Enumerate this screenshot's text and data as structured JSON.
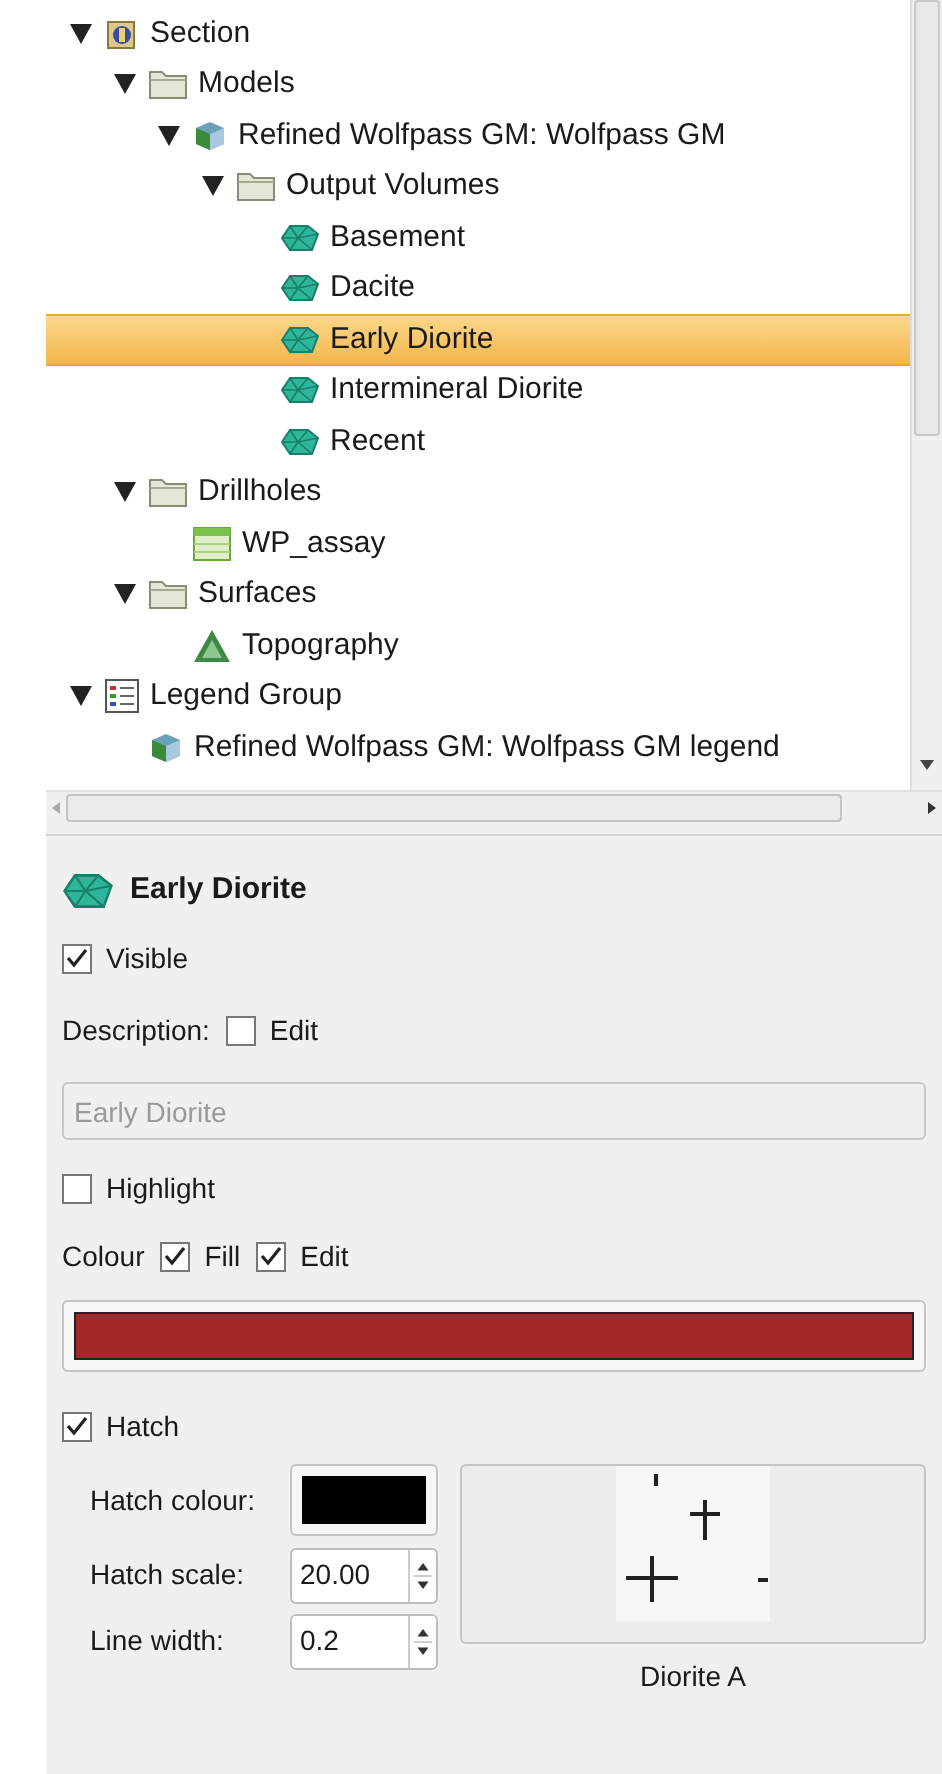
{
  "tree": {
    "nodes": [
      {
        "label": "Section",
        "kind": "section",
        "expanded": true,
        "selected": false,
        "children": [
          {
            "label": "Models",
            "kind": "folder",
            "expanded": true,
            "selected": false,
            "children": [
              {
                "label": "Refined Wolfpass GM: Wolfpass GM",
                "kind": "model",
                "expanded": true,
                "selected": false,
                "children": [
                  {
                    "label": "Output Volumes",
                    "kind": "folder",
                    "expanded": true,
                    "selected": false,
                    "children": [
                      {
                        "label": "Basement",
                        "kind": "volume",
                        "selected": false
                      },
                      {
                        "label": "Dacite",
                        "kind": "volume",
                        "selected": false
                      },
                      {
                        "label": "Early Diorite",
                        "kind": "volume",
                        "selected": true
                      },
                      {
                        "label": "Intermineral Diorite",
                        "kind": "volume",
                        "selected": false
                      },
                      {
                        "label": "Recent",
                        "kind": "volume",
                        "selected": false
                      }
                    ]
                  }
                ]
              }
            ]
          },
          {
            "label": "Drillholes",
            "kind": "folder",
            "expanded": true,
            "selected": false,
            "children": [
              {
                "label": "WP_assay",
                "kind": "table",
                "selected": false
              }
            ]
          },
          {
            "label": "Surfaces",
            "kind": "folder",
            "expanded": true,
            "selected": false,
            "children": [
              {
                "label": "Topography",
                "kind": "surface",
                "selected": false
              }
            ]
          }
        ]
      },
      {
        "label": "Legend Group",
        "kind": "legend",
        "expanded": true,
        "selected": false,
        "children": [
          {
            "label": "Refined Wolfpass GM: Wolfpass GM legend",
            "kind": "model",
            "selected": false
          }
        ]
      }
    ]
  },
  "properties": {
    "title": "Early Diorite",
    "visible": {
      "label": "Visible",
      "checked": true
    },
    "description": {
      "label": "Description:",
      "edit_label": "Edit",
      "edit_checked": false
    },
    "description_field": {
      "value": "Early Diorite",
      "disabled": true
    },
    "highlight": {
      "label": "Highlight",
      "checked": false
    },
    "colour": {
      "label": "Colour",
      "fill_label": "Fill",
      "fill_checked": true,
      "edit_label": "Edit",
      "edit_checked": true,
      "color": "#a3282a"
    },
    "hatch": {
      "label": "Hatch",
      "checked": true
    },
    "hatch_colour": {
      "label": "Hatch colour:",
      "color": "#000000"
    },
    "hatch_scale": {
      "label": "Hatch scale:",
      "value": "20.00"
    },
    "line_width": {
      "label": "Line width:",
      "value": "0.2"
    },
    "pattern": {
      "name": "Diorite A"
    }
  }
}
